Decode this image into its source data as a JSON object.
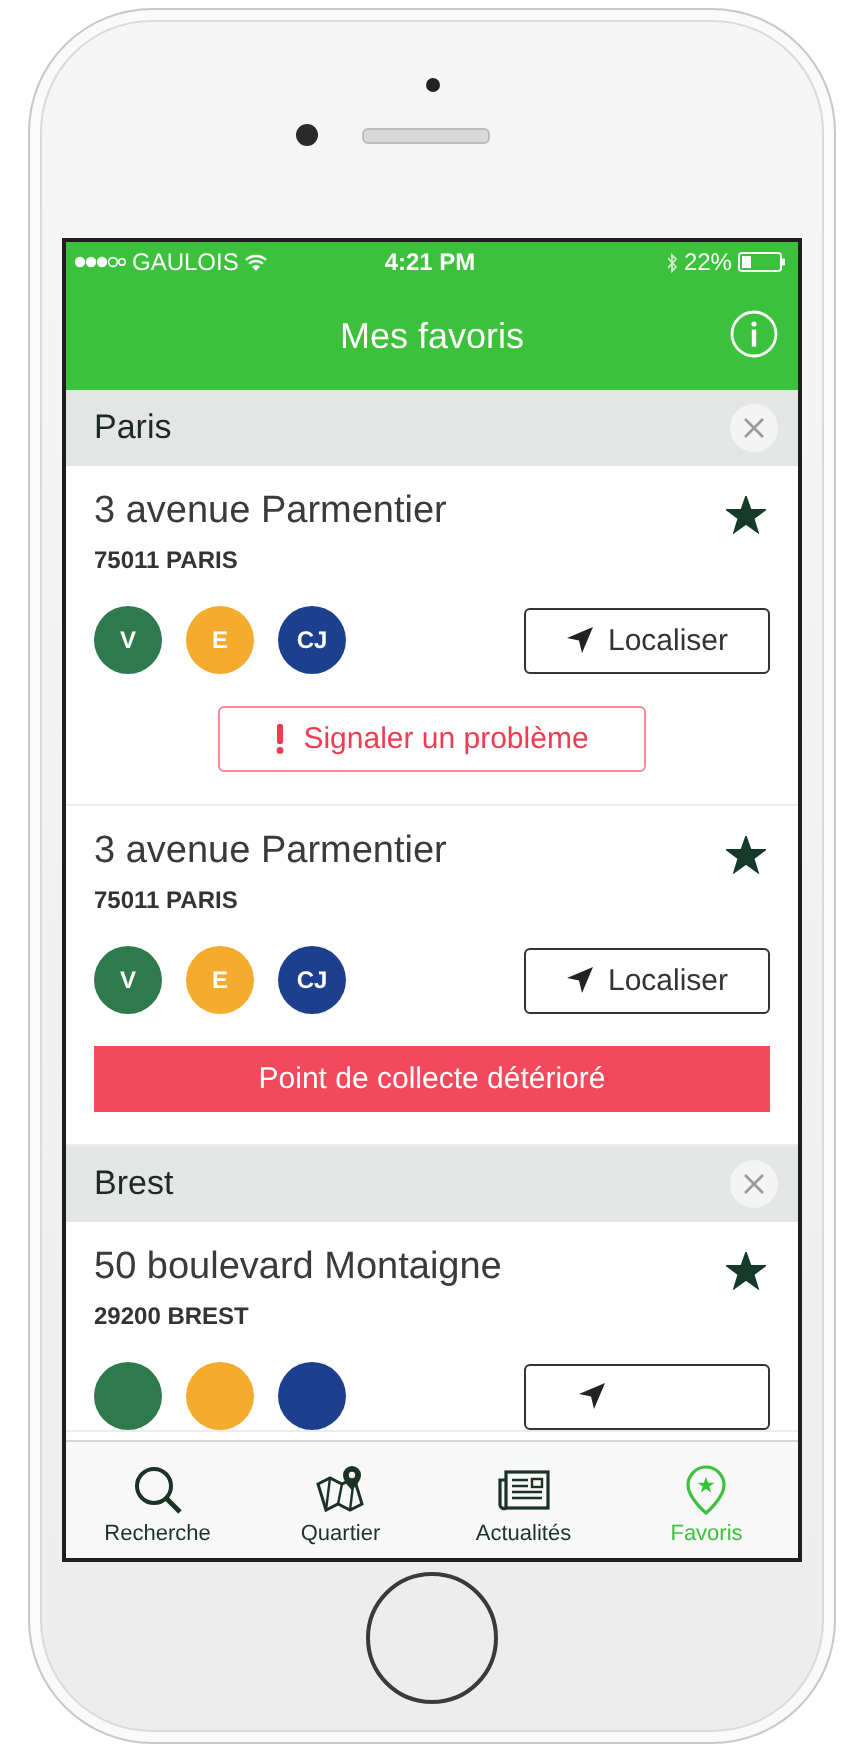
{
  "status_bar": {
    "carrier": "GAULOIS",
    "time": "4:21 PM",
    "battery": "22%"
  },
  "nav_bar": {
    "title": "Mes favoris"
  },
  "sections": [
    {
      "title": "Paris",
      "items": [
        {
          "address": "3 avenue Parmentier",
          "city": "75011 PARIS",
          "favorite": true,
          "badges": [
            {
              "label": "V",
              "color": "#2e7a4c"
            },
            {
              "label": "E",
              "color": "#f5ab2e"
            },
            {
              "label": "CJ",
              "color": "#1c3f8e"
            }
          ],
          "locate_button": {
            "label": "Localiser"
          },
          "footer": {
            "kind": "report",
            "label": "Signaler un problème"
          }
        },
        {
          "address": "3 avenue Parmentier",
          "city": "75011 PARIS",
          "favorite": true,
          "badges": [
            {
              "label": "V",
              "color": "#2e7a4c"
            },
            {
              "label": "E",
              "color": "#f5ab2e"
            },
            {
              "label": "CJ",
              "color": "#1c3f8e"
            }
          ],
          "locate_button": {
            "label": "Localiser"
          },
          "footer": {
            "kind": "alert",
            "label": "Point de collecte détérioré"
          }
        }
      ]
    },
    {
      "title": "Brest",
      "items": [
        {
          "address": "50 boulevard Montaigne",
          "city": "29200 BREST",
          "favorite": true,
          "badges": [
            {
              "color": "#2e7a4c"
            },
            {
              "color": "#f5ab2e"
            },
            {
              "color": "#1c3f8e"
            }
          ],
          "locate_button": {
            "cut": true
          }
        }
      ]
    }
  ],
  "tab_bar": [
    {
      "kind": "search",
      "label": "Recherche",
      "selected": false
    },
    {
      "kind": "map",
      "label": "Quartier",
      "selected": false
    },
    {
      "kind": "news",
      "label": "Actualités",
      "selected": false
    },
    {
      "kind": "favorites",
      "label": "Favoris",
      "selected": true
    }
  ]
}
